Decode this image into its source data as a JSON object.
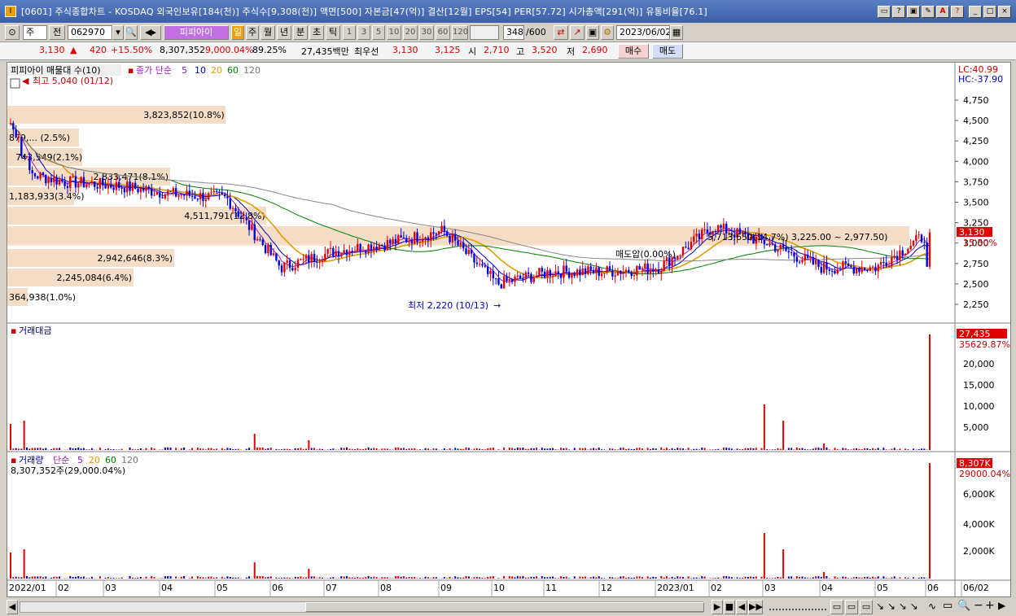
{
  "window": {
    "title": "[0601] 주식종합차트 - KOSDAQ 외국인보유[184(천)] 주식수[9,308(천)] 액면[500] 자본금[47(억)] 결산[12월] EPS[54] PER[57.72] 시가총액[291(억)] 유통비율[76.1]",
    "controls": [
      "□",
      "?",
      "□",
      "✎",
      "A",
      "?",
      "_",
      "□",
      "×"
    ]
  },
  "toolbar": {
    "market_type": "주",
    "all_label": "전",
    "code": "062970",
    "stock_name": "피피아이",
    "periods": [
      "일",
      "주",
      "월",
      "년",
      "분",
      "초",
      "틱"
    ],
    "intervals": [
      "1",
      "3",
      "5",
      "10",
      "20",
      "30",
      "60",
      "120"
    ],
    "count": "348",
    "count_max": "/600",
    "date": "2023/06/02"
  },
  "quote": {
    "price": "3,130",
    "change": "420",
    "change_pct": "+15.50%",
    "volume": "8,307,352",
    "volume_ratio": "9,000.04%",
    "turnover": "89.25%",
    "amount": "27,435백만",
    "priority_label": "최우선",
    "ask": "3,130",
    "bid": "3,125",
    "open_label": "시",
    "open": "2,710",
    "high_label": "고",
    "high": "3,520",
    "low_label": "저",
    "low": "2,690",
    "buy_label": "매수",
    "sell_label": "매도"
  },
  "price_panel": {
    "legend_name": "피피아이 매물대 수(10)",
    "ma_label": "종가 단순",
    "ma_periods": [
      "5",
      "10",
      "20",
      "60",
      "120"
    ],
    "lc": "LC:40.99",
    "hc": "HC:-37.90",
    "last_price_tag": "3,130",
    "last_pct_tag": "15.50%",
    "high_marker": "최고 5,040 (01/12)",
    "low_marker": "최저 2,220 (10/13)",
    "highlight_label": "5,713,650(14.7%) 3,225.00 ~ 2,977.50)",
    "prev_label": "매도압(0.00%)",
    "y_ticks": [
      "4,750",
      "4,500",
      "4,250",
      "4,000",
      "3,750",
      "3,500",
      "3,250",
      "3,000",
      "2,750",
      "2,500",
      "2,250"
    ],
    "volume_profile": [
      {
        "label": "364,938(1.0%)"
      },
      {
        "label": "2,245,084(6.4%)"
      },
      {
        "label": "2,942,646(8.3%)"
      },
      {
        "label": "5,713,650(14.7%)"
      },
      {
        "label": "4,511,791(12.8%)"
      },
      {
        "label": "1,183,933(3.4%)"
      },
      {
        "label": "2,833,471(8.1%)"
      },
      {
        "label": "743,549(2.1%)"
      },
      {
        "label": "879,... (2.5%)"
      },
      {
        "label": "3,823,852(10.8%)"
      }
    ]
  },
  "amount_panel": {
    "legend": "거래대금",
    "tag_value": "27,435",
    "tag_sub": "35629.87%",
    "y_ticks": [
      "20,000",
      "15,000",
      "10,000",
      "5,000"
    ]
  },
  "volume_panel": {
    "legend": "거래량",
    "ma_label": "단순",
    "ma_periods": [
      "5",
      "20",
      "60",
      "120"
    ],
    "value_text": "8,307,352주(29,000.04%)",
    "tag_value": "8,307K",
    "tag_sub": "29000.04%",
    "y_ticks": [
      "6,000K",
      "4,000K",
      "2,000K"
    ]
  },
  "x_axis": {
    "labels": [
      "2022/01",
      "02",
      "03",
      "04",
      "05",
      "06",
      "07",
      "08",
      "09",
      "10",
      "11",
      "12",
      "2023/01",
      "02",
      "03",
      "04",
      "05",
      "06",
      "06/02"
    ]
  },
  "chart_data": {
    "type": "candlestick",
    "title": "피피아이 (062970) 일봉",
    "x_range": [
      "2022/01",
      "2023/06/02"
    ],
    "y_range": [
      2200,
      5100
    ],
    "monthly_close_approx": [
      {
        "month": "2022/01",
        "price": 3900
      },
      {
        "month": "2022/02",
        "price": 3750
      },
      {
        "month": "2022/03",
        "price": 3700
      },
      {
        "month": "2022/04",
        "price": 3600
      },
      {
        "month": "2022/05",
        "price": 3550
      },
      {
        "month": "2022/06",
        "price": 2700
      },
      {
        "month": "2022/07",
        "price": 2900
      },
      {
        "month": "2022/08",
        "price": 3000
      },
      {
        "month": "2022/09",
        "price": 3150
      },
      {
        "month": "2022/10",
        "price": 2500
      },
      {
        "month": "2022/11",
        "price": 2650
      },
      {
        "month": "2022/12",
        "price": 2650
      },
      {
        "month": "2023/01",
        "price": 2700
      },
      {
        "month": "2023/02",
        "price": 3200
      },
      {
        "month": "2023/03",
        "price": 3000
      },
      {
        "month": "2023/04",
        "price": 2700
      },
      {
        "month": "2023/05",
        "price": 2700
      },
      {
        "month": "2023/06",
        "price": 3130
      }
    ],
    "high": {
      "value": 5040,
      "date": "01/12"
    },
    "low": {
      "value": 2220,
      "date": "10/13"
    },
    "last": 3130
  }
}
